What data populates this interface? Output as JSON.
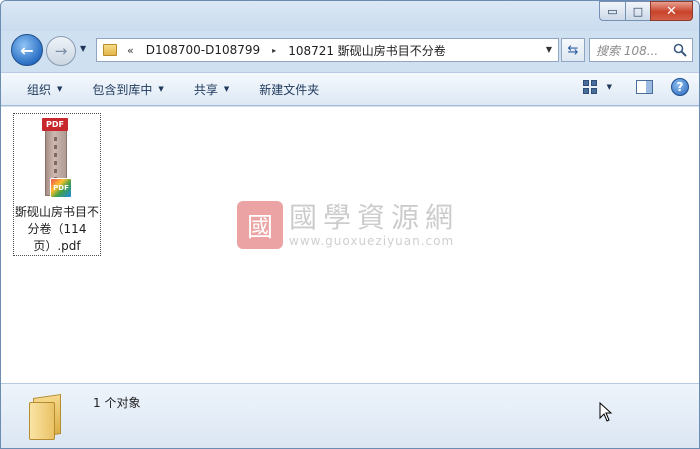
{
  "window": {
    "caption_buttons": {
      "minimize": "▭",
      "maximize": "□",
      "close": "✕"
    }
  },
  "nav": {
    "back_icon": "←",
    "forward_icon": "→",
    "history_icon": "▼"
  },
  "address": {
    "overflow": "«",
    "segments": [
      "D108700-D108799",
      "108721 斲砚山房书目不分卷"
    ],
    "separator": "▸",
    "dropdown": "▼"
  },
  "refresh_icon": "⇆",
  "search": {
    "placeholder": "搜索 108..."
  },
  "toolbar": {
    "organize": "组织",
    "include_in_library": "包含到库中",
    "share": "共享",
    "new_folder": "新建文件夹",
    "caret": "▼",
    "help": "?"
  },
  "files": [
    {
      "name": "斲砚山房书目不分卷（114页）.pdf",
      "thumb_label_top": "PDF",
      "thumb_label_badge": "PDF"
    }
  ],
  "watermark": {
    "seal": "國",
    "title": "國學資源網",
    "url": "www.guoxueziyuan.com"
  },
  "status": {
    "count_text": "1 个对象"
  },
  "colors": {
    "accent": "#2a6fc4",
    "close": "#c8432a",
    "seal": "#d84a4a"
  }
}
